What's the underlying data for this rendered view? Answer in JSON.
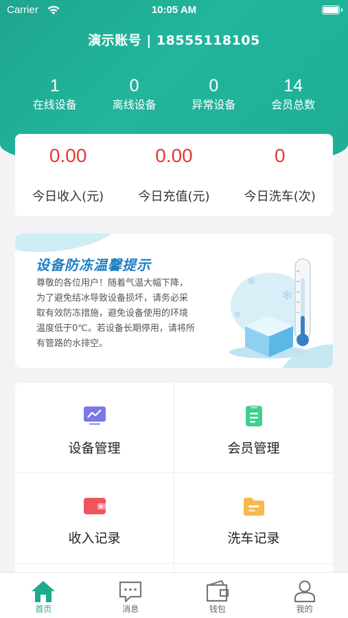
{
  "status_bar": {
    "carrier": "Carrier",
    "time": "10:05 AM"
  },
  "header": {
    "account": "演示账号 | 18555118105"
  },
  "stats": [
    {
      "value": "1",
      "label": "在线设备"
    },
    {
      "value": "0",
      "label": "离线设备"
    },
    {
      "value": "0",
      "label": "异常设备"
    },
    {
      "value": "14",
      "label": "会员总数"
    }
  ],
  "income": [
    {
      "value": "0.00",
      "label": "今日收入(元)"
    },
    {
      "value": "0.00",
      "label": "今日充值(元)"
    },
    {
      "value": "0",
      "label": "今日洗车(次)"
    }
  ],
  "notice": {
    "title": "设备防冻温馨提示",
    "lines": [
      "尊敬的各位用户！随着气温大幅下降，",
      "为了避免结冰导致设备损坏，请务必采",
      "取有效防冻措施，避免设备使用的环境",
      "温度低于0℃。若设备长期停用，请将所",
      "有管路的水排空。"
    ]
  },
  "menu": [
    {
      "label": "设备管理",
      "icon": "monitor-chart-icon",
      "color": "#7b78e8"
    },
    {
      "label": "会员管理",
      "icon": "clipboard-icon",
      "color": "#3ecf8e"
    },
    {
      "label": "收入记录",
      "icon": "wallet-icon",
      "color": "#f0555e"
    },
    {
      "label": "洗车记录",
      "icon": "folder-icon",
      "color": "#f7b94a"
    }
  ],
  "tabs": [
    {
      "label": "首页",
      "icon": "home-icon",
      "active": true
    },
    {
      "label": "消息",
      "icon": "message-icon",
      "active": false
    },
    {
      "label": "钱包",
      "icon": "wallet-icon",
      "active": false
    },
    {
      "label": "我的",
      "icon": "user-icon",
      "active": false
    }
  ],
  "colors": {
    "primary": "#1faa8f",
    "accent_red": "#e53935"
  }
}
